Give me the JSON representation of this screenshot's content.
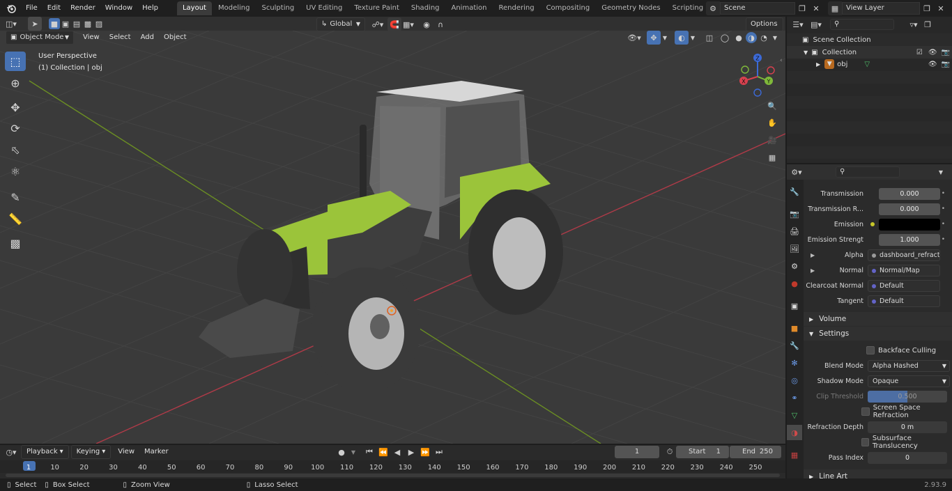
{
  "topbar": {
    "menus": [
      "File",
      "Edit",
      "Render",
      "Window",
      "Help"
    ],
    "workspaces": [
      "Layout",
      "Modeling",
      "Sculpting",
      "UV Editing",
      "Texture Paint",
      "Shading",
      "Animation",
      "Rendering",
      "Compositing",
      "Geometry Nodes",
      "Scripting"
    ],
    "active_workspace": "Layout",
    "scene": "Scene",
    "view_layer": "View Layer"
  },
  "viewport_header": {
    "mode": "Object Mode",
    "menus": [
      "View",
      "Select",
      "Add",
      "Object"
    ],
    "orientation": "Global",
    "options": "Options"
  },
  "viewport": {
    "perspective": "User Perspective",
    "collection_info": "(1) Collection | obj",
    "gizmo": {
      "x": "X",
      "y": "Y",
      "z": "Z"
    }
  },
  "toolbar_icons": [
    "select-box-icon",
    "cursor-icon",
    "move-icon",
    "rotate-icon",
    "scale-icon",
    "transform-icon",
    "annotate-icon",
    "measure-icon",
    "add-cube-icon"
  ],
  "outliner": {
    "scene_collection": "Scene Collection",
    "collection": "Collection",
    "object": "obj"
  },
  "properties": {
    "rows": [
      {
        "label": "Transmission",
        "value": "0.000",
        "type": "slider",
        "socket": "#9a9a9a"
      },
      {
        "label": "Transmission R...",
        "value": "0.000",
        "type": "slider",
        "socket": "#9a9a9a"
      },
      {
        "label": "Emission",
        "value": "",
        "type": "color",
        "socket": "#c7c729"
      },
      {
        "label": "Emission Strengt",
        "value": "1.000",
        "type": "slider",
        "socket": "#9a9a9a"
      },
      {
        "label": "Alpha",
        "value": "dashboard_refractio...",
        "type": "link",
        "socket": "#9a9a9a",
        "expand": true
      },
      {
        "label": "Normal",
        "value": "Normal/Map",
        "type": "link",
        "socket": "#6363c7",
        "expand": true
      },
      {
        "label": "Clearcoat Normal",
        "value": "Default",
        "type": "link",
        "socket": "#6363c7"
      },
      {
        "label": "Tangent",
        "value": "Default",
        "type": "link",
        "socket": "#6363c7"
      }
    ],
    "sections": {
      "volume": "Volume",
      "settings": "Settings",
      "line_art": "Line Art"
    },
    "settings": {
      "backface_culling": "Backface Culling",
      "blend_mode_label": "Blend Mode",
      "blend_mode": "Alpha Hashed",
      "shadow_mode_label": "Shadow Mode",
      "shadow_mode": "Opaque",
      "clip_threshold_label": "Clip Threshold",
      "clip_threshold": "0.500",
      "screen_space_refraction": "Screen Space Refraction",
      "refraction_depth_label": "Refraction Depth",
      "refraction_depth": "0 m",
      "subsurface_translucency": "Subsurface Translucency",
      "pass_index_label": "Pass Index",
      "pass_index": "0"
    }
  },
  "timeline": {
    "menus": [
      "Playback",
      "Keying",
      "View",
      "Marker"
    ],
    "current_frame": "1",
    "start_label": "Start",
    "start": "1",
    "end_label": "End",
    "end": "250",
    "ticks": [
      "1",
      "10",
      "20",
      "30",
      "40",
      "50",
      "60",
      "70",
      "80",
      "90",
      "100",
      "110",
      "120",
      "130",
      "140",
      "150",
      "160",
      "170",
      "180",
      "190",
      "200",
      "210",
      "220",
      "230",
      "240",
      "250"
    ]
  },
  "statusbar": {
    "select": "Select",
    "box_select": "Box Select",
    "zoom_view": "Zoom View",
    "lasso_select": "Lasso Select",
    "version": "2.93.9"
  }
}
